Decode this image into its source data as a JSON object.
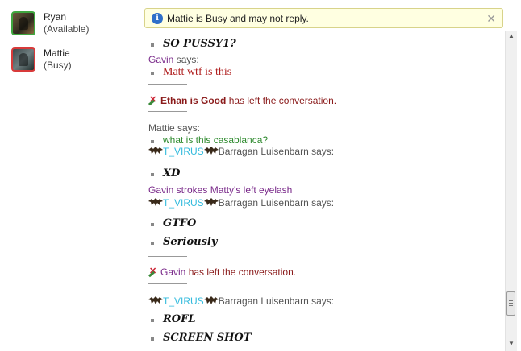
{
  "contacts": [
    {
      "name": "Ryan",
      "status": "(Available)",
      "presence": "available"
    },
    {
      "name": "Mattie",
      "status": "(Busy)",
      "presence": "busy"
    }
  ],
  "infobar": {
    "text": "Mattie is Busy and may not reply.",
    "icon": "info-icon",
    "close_icon": "close-icon"
  },
  "chat": {
    "m1_text": "SO PUSSY1?",
    "m2_sender": "Gavin",
    "m2_says": "says:",
    "m2_text": "Matt wtf is this",
    "m3_name": "Ethan is Good",
    "m3_text": "has left the conversation.",
    "m4_sender": "Mattie says:",
    "m4_text": "what is this casablanca?",
    "m5_tag": "T_VIRUS",
    "m5_name": "Barragan Luisenbarn says:",
    "m5_text": "XD",
    "m6_text": "Gavin strokes Matty's left eyelash",
    "m7_tag": "T_VIRUS",
    "m7_name": "Barragan Luisenbarn says:",
    "m7_text1": "GTFO",
    "m7_text2": "Seriously",
    "m8_name": "Gavin",
    "m8_text": "has left the conversation.",
    "m9_tag": "T_VIRUS",
    "m9_name": "Barragan Luisenbarn says:",
    "m9_text1": "ROFL",
    "m9_text2": "SCREEN SHOT"
  },
  "colors": {
    "available": "#3fa73f",
    "busy": "#d83a3a",
    "infobar_bg": "#ffffe1",
    "link_purple": "#7a2a8a",
    "tag_cyan": "#33bbdd"
  }
}
